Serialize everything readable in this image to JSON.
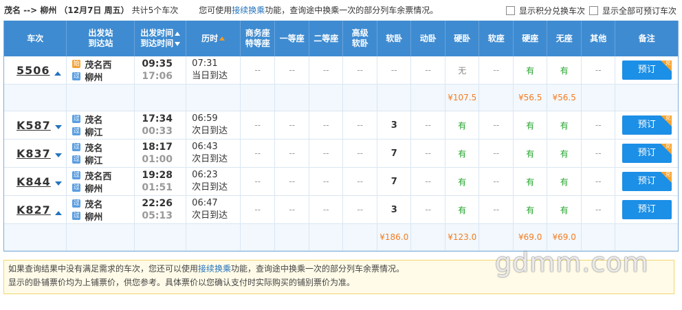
{
  "query": {
    "route": "茂名 --> 柳州",
    "date": "（12月7日 周五）",
    "count": "共计5个车次",
    "hint_pre": "您可使用",
    "hint_link": "接续换乘",
    "hint_post": "功能，查询途中换乘一次的部分列车余票情况。",
    "cb_points": "显示积分兑换车次",
    "cb_all": "显示全部可预订车次"
  },
  "headers": {
    "train": "车次",
    "station_top": "出发站",
    "station_bot": "到达站",
    "time_top": "出发时间",
    "time_bot": "到达时间",
    "duration": "历时",
    "biz_top": "商务座",
    "biz_bot": "特等座",
    "first": "一等座",
    "second": "二等座",
    "adv_top": "高级",
    "adv_bot": "软卧",
    "soft_sleeper": "软卧",
    "dong_sleeper": "动卧",
    "hard_sleeper": "硬卧",
    "soft_seat": "软座",
    "hard_seat": "硬座",
    "no_seat": "无座",
    "other": "其他",
    "remark": "备注"
  },
  "book_label": "预订",
  "dui_label": "兑",
  "trains": [
    {
      "no": "5506",
      "arrow": "up",
      "from": "茂名西",
      "from_badge": "始",
      "to": "柳州",
      "to_badge": "过",
      "depart": "09:35",
      "arrive": "17:06",
      "duration": "07:31",
      "arrive_day": "当日到达",
      "seats": [
        "--",
        "--",
        "--",
        "--",
        "--",
        "--",
        "无",
        "--",
        "有",
        "有",
        "--"
      ],
      "dui": true,
      "prices": [
        "",
        "",
        "",
        "",
        "",
        "",
        "¥107.5",
        "",
        "¥56.5",
        "¥56.5",
        ""
      ]
    },
    {
      "no": "K587",
      "arrow": "down",
      "from": "茂名",
      "from_badge": "过",
      "to": "柳江",
      "to_badge": "过",
      "depart": "17:34",
      "arrive": "00:33",
      "duration": "06:59",
      "arrive_day": "次日到达",
      "seats": [
        "--",
        "--",
        "--",
        "--",
        "3",
        "--",
        "有",
        "--",
        "有",
        "有",
        "--"
      ],
      "dui": true
    },
    {
      "no": "K837",
      "arrow": "down",
      "from": "茂名",
      "from_badge": "过",
      "to": "柳江",
      "to_badge": "过",
      "depart": "18:17",
      "arrive": "01:00",
      "duration": "06:43",
      "arrive_day": "次日到达",
      "seats": [
        "--",
        "--",
        "--",
        "--",
        "7",
        "--",
        "有",
        "--",
        "有",
        "有",
        "--"
      ],
      "dui": true
    },
    {
      "no": "K844",
      "arrow": "down",
      "from": "茂名西",
      "from_badge": "过",
      "to": "柳州",
      "to_badge": "过",
      "depart": "19:28",
      "arrive": "01:51",
      "duration": "06:23",
      "arrive_day": "次日到达",
      "seats": [
        "--",
        "--",
        "--",
        "--",
        "7",
        "--",
        "有",
        "--",
        "有",
        "有",
        "--"
      ],
      "dui": true
    },
    {
      "no": "K827",
      "arrow": "up",
      "from": "茂名",
      "from_badge": "过",
      "to": "柳州",
      "to_badge": "过",
      "depart": "22:26",
      "arrive": "05:13",
      "duration": "06:47",
      "arrive_day": "次日到达",
      "seats": [
        "--",
        "--",
        "--",
        "--",
        "3",
        "--",
        "有",
        "--",
        "有",
        "有",
        "--"
      ],
      "dui": false,
      "prices": [
        "",
        "",
        "",
        "",
        "¥186.0",
        "",
        "¥123.0",
        "",
        "¥69.0",
        "¥69.0",
        ""
      ]
    }
  ],
  "notice": {
    "line1_pre": "如果查询结果中没有满足需求的车次，您还可以使用",
    "line1_link": "接续换乘",
    "line1_post": "功能，查询途中换乘一次的部分列车余票情况。",
    "line2": "显示的卧铺票价均为上铺票价，供您参考。具体票价以您确认支付时实际购买的铺别票价为准。"
  },
  "watermark": "gdmm.com",
  "colors": {
    "header_bg": "#3e8bd1",
    "available": "#22a42a",
    "price": "#f47b20",
    "book": "#1c8fe6",
    "dui_badge": "#f7a531"
  }
}
